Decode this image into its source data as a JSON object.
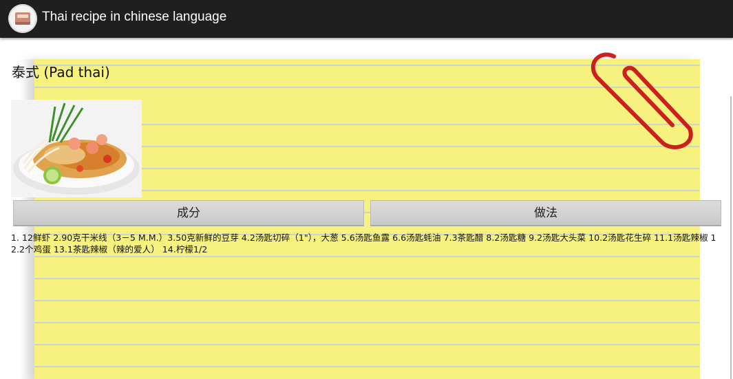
{
  "app": {
    "title": "Thai recipe in chinese language",
    "icon": "recipe-book-icon"
  },
  "recipe": {
    "title": "泰式 (Pad thai)",
    "image_alt": "pad-thai-dish-photo",
    "tabs": [
      {
        "label": "成分"
      },
      {
        "label": "做法"
      }
    ],
    "ingredients_text": "1. 12鲜虾 2.90克干米线（3－5 M.M.）3.50克新鲜的豆芽 4.2汤匙切碎（1\"），大葱 5.6汤匙鱼露 6.6汤匙蚝油 7.3茶匙醋 8.2汤匙糖 9.2汤匙大头菜 10.2汤匙花生碎 11.1汤匙辣椒 12.2个鸡蛋 13.1茶匙辣椒（辣的爱人） 14.柠檬1/2"
  },
  "colors": {
    "actionbar": "#1f1f1f",
    "notepad": "#f7f27f",
    "paperclip": "#cc1f1f"
  }
}
